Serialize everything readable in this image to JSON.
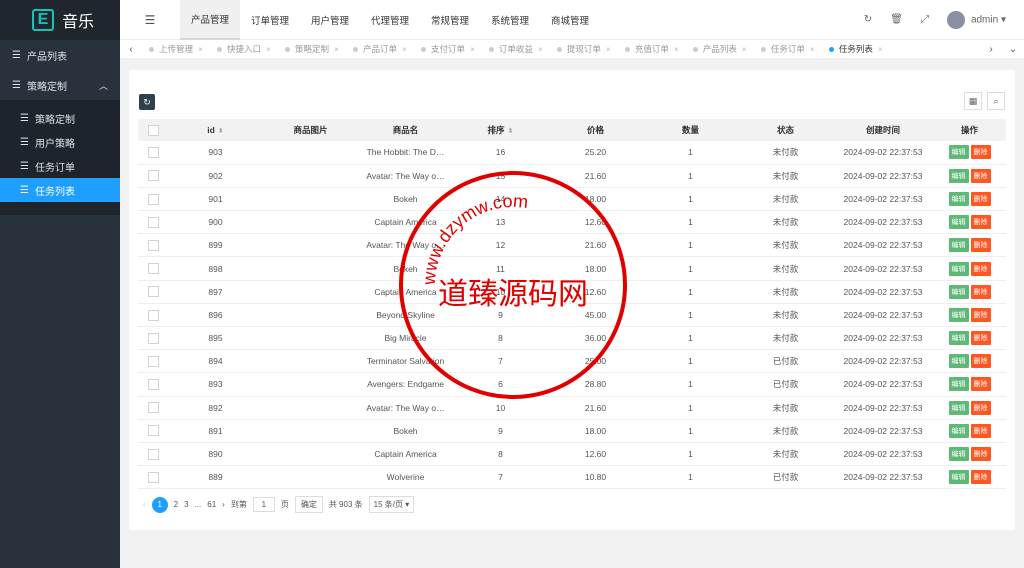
{
  "app": {
    "title": "音乐",
    "logo_letter": "E"
  },
  "sidebar": {
    "item1": "产品列表",
    "group": "策略定制",
    "subs": [
      "策略定制",
      "用户策略",
      "任务订单",
      "任务列表"
    ]
  },
  "topnav": [
    "产品管理",
    "订单管理",
    "用户管理",
    "代理管理",
    "常规管理",
    "系统管理",
    "商城管理"
  ],
  "user": {
    "name": "admin"
  },
  "tabs": [
    "上传管理",
    "快捷入口",
    "策略定制",
    "产品订单",
    "支付订单",
    "订单收益",
    "提现订单",
    "充值订单",
    "产品列表",
    "任务订单",
    "任务列表"
  ],
  "table": {
    "headers": [
      "id",
      "商品图片",
      "商品名",
      "排序",
      "价格",
      "数量",
      "状态",
      "创建时间",
      "操作"
    ],
    "edit": "编辑",
    "del": "删除",
    "rows": [
      [
        "903",
        "The Hobbit: The D…",
        "16",
        "25.20",
        "1",
        "未付款",
        "2024-09-02 22:37:53"
      ],
      [
        "902",
        "Avatar: The Way o…",
        "15",
        "21.60",
        "1",
        "未付款",
        "2024-09-02 22:37:53"
      ],
      [
        "901",
        "Bokeh",
        "14",
        "18.00",
        "1",
        "未付款",
        "2024-09-02 22:37:53"
      ],
      [
        "900",
        "Captain America",
        "13",
        "12.60",
        "1",
        "未付款",
        "2024-09-02 22:37:53"
      ],
      [
        "899",
        "Avatar: The Way o…",
        "12",
        "21.60",
        "1",
        "未付款",
        "2024-09-02 22:37:53"
      ],
      [
        "898",
        "Bokeh",
        "11",
        "18.00",
        "1",
        "未付款",
        "2024-09-02 22:37:53"
      ],
      [
        "897",
        "Captain America",
        "10",
        "12.60",
        "1",
        "未付款",
        "2024-09-02 22:37:53"
      ],
      [
        "896",
        "Beyond Skyline",
        "9",
        "45.00",
        "1",
        "未付款",
        "2024-09-02 22:37:53"
      ],
      [
        "895",
        "Big Miracle",
        "8",
        "36.00",
        "1",
        "未付款",
        "2024-09-02 22:37:53"
      ],
      [
        "894",
        "Terminator Salvation",
        "7",
        "25.00",
        "1",
        "已付款",
        "2024-09-02 22:37:53"
      ],
      [
        "893",
        "Avengers: Endgame",
        "6",
        "28.80",
        "1",
        "已付款",
        "2024-09-02 22:37:53"
      ],
      [
        "892",
        "Avatar: The Way o…",
        "10",
        "21.60",
        "1",
        "未付款",
        "2024-09-02 22:37:53"
      ],
      [
        "891",
        "Bokeh",
        "9",
        "18.00",
        "1",
        "未付款",
        "2024-09-02 22:37:53"
      ],
      [
        "890",
        "Captain America",
        "8",
        "12.60",
        "1",
        "未付款",
        "2024-09-02 22:37:53"
      ],
      [
        "889",
        "Wolverine",
        "7",
        "10.80",
        "1",
        "已付款",
        "2024-09-02 22:37:53"
      ]
    ]
  },
  "pager": {
    "current": "1",
    "p2": "2",
    "p3": "3",
    "ellipsis": "...",
    "last": "61",
    "goto": "到第",
    "page_value": "1",
    "page_unit": "页",
    "confirm": "确定",
    "total": "共 903 条",
    "per_page": "15 条/页"
  },
  "watermark": {
    "main": "道臻源码网",
    "ring": "www.dzymw.com"
  }
}
